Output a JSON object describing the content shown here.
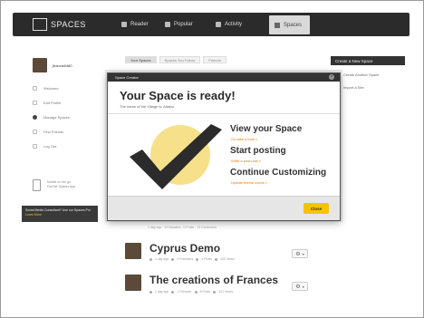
{
  "header": {
    "logo_text": "SPACES",
    "nav": [
      {
        "label": "Reader"
      },
      {
        "label": "Popular"
      },
      {
        "label": "Activity"
      },
      {
        "label": "Spaces"
      }
    ]
  },
  "sidebar": {
    "username": "jfrancis5480",
    "items": [
      {
        "label": "Welcome"
      },
      {
        "label": "Edit Profile"
      },
      {
        "label": "Manage Spaces"
      },
      {
        "label": "Find Friends"
      },
      {
        "label": "Log Out"
      }
    ],
    "mobile_line1": "Mobile on the go",
    "mobile_line2": "Get the Spaces App",
    "promo_text": "Social Media Consultant? Use our Spaces Pro",
    "promo_link": "Learn More"
  },
  "tabs": [
    "Your Spaces",
    "Spaces You Follow",
    "Friends"
  ],
  "right_panel": {
    "title": "Create a New Space",
    "items": [
      "Create Another Space",
      "Import a Site"
    ]
  },
  "modal": {
    "header": "Space Creator",
    "title": "Your Space is ready!",
    "subtitle": "The name of the Village is: Adaics",
    "options": [
      {
        "title": "View your Space",
        "link": "Go take a look »"
      },
      {
        "title": "Start posting",
        "link": "Write a post now »"
      },
      {
        "title": "Continue Customizing",
        "link": "Update theme colors »"
      }
    ],
    "close_label": "Close"
  },
  "list_strip": "1 day ago · 3 Followers · 0 Posts · 12 Comments",
  "spaces": [
    {
      "name": "Cyprus Demo",
      "meta": [
        "1 day ago",
        "0 Followers",
        "0 Posts",
        "100 Views"
      ]
    },
    {
      "name": "The creations of Frances",
      "meta": [
        "1 day ago",
        "1 Follower",
        "5 Posts",
        "121 Views"
      ]
    }
  ],
  "colors": {
    "accent": "#f5c400",
    "topbar": "#2b2b2b",
    "link": "#e07a00"
  }
}
